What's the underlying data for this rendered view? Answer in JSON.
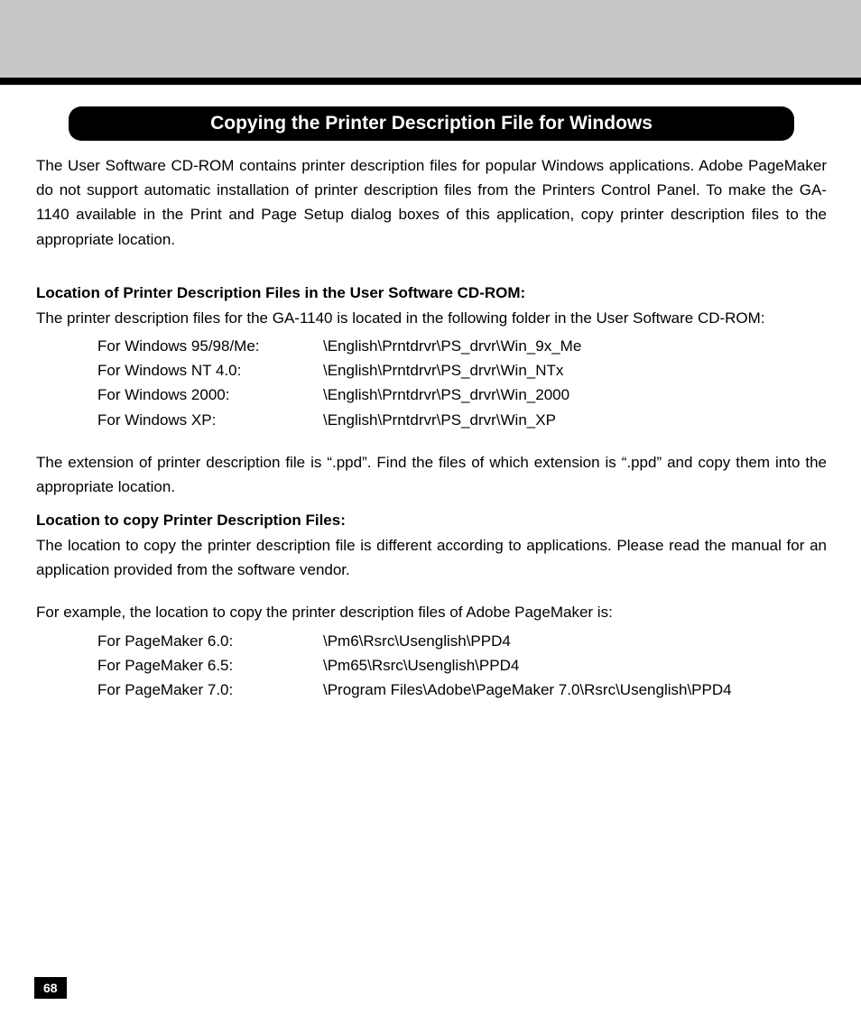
{
  "header": {
    "title": "Copying the Printer Description File for Windows"
  },
  "intro": "The User Software CD-ROM contains printer description files for popular Windows applications.  Adobe PageMaker do not support automatic installation of printer description files from the Printers Control Panel.  To make the GA-1140 available in the Print and Page Setup dialog boxes of this application, copy printer description files to the appropriate location.",
  "section1": {
    "heading": "Location of Printer Description Files in the User Software CD-ROM:",
    "lead": "The printer description files for the GA-1140 is located in the following folder in the User Software CD-ROM:",
    "rows": [
      {
        "label": "For Windows 95/98/Me:",
        "value": "\\English\\Prntdrvr\\PS_drvr\\Win_9x_Me"
      },
      {
        "label": "For Windows NT 4.0:",
        "value": "\\English\\Prntdrvr\\PS_drvr\\Win_NTx"
      },
      {
        "label": "For Windows 2000:",
        "value": "\\English\\Prntdrvr\\PS_drvr\\Win_2000"
      },
      {
        "label": "For Windows XP:",
        "value": "\\English\\Prntdrvr\\PS_drvr\\Win_XP"
      }
    ],
    "note": "The extension of printer description file is “.ppd”.  Find the files of which extension is “.ppd” and copy them into the appropriate location."
  },
  "section2": {
    "heading": "Location to copy Printer Description Files:",
    "lead": "The location to copy the printer description file is different according to applications.  Please read the manual for an application provided from the software vendor.",
    "example_intro": "For example, the location to copy the printer description files of Adobe PageMaker is:",
    "rows": [
      {
        "label": "For PageMaker 6.0:",
        "value": "\\Pm6\\Rsrc\\Usenglish\\PPD4"
      },
      {
        "label": "For PageMaker 6.5:",
        "value": "\\Pm65\\Rsrc\\Usenglish\\PPD4"
      },
      {
        "label": "For PageMaker 7.0:",
        "value": "\\Program Files\\Adobe\\PageMaker 7.0\\Rsrc\\Usenglish\\PPD4"
      }
    ]
  },
  "page_number": "68"
}
